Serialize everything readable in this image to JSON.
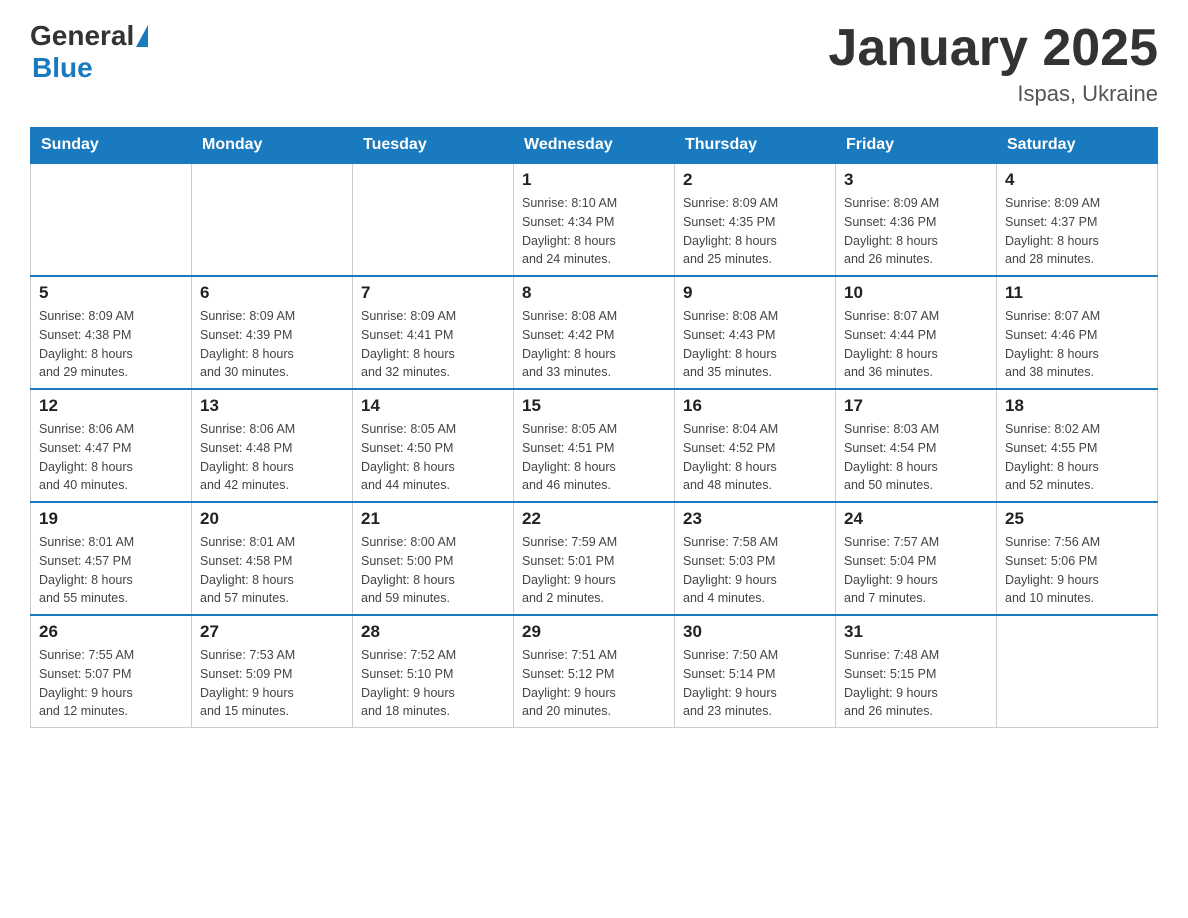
{
  "header": {
    "logo_general": "General",
    "logo_blue": "Blue",
    "month_title": "January 2025",
    "location": "Ispas, Ukraine"
  },
  "days_of_week": [
    "Sunday",
    "Monday",
    "Tuesday",
    "Wednesday",
    "Thursday",
    "Friday",
    "Saturday"
  ],
  "weeks": [
    [
      {
        "day": "",
        "info": ""
      },
      {
        "day": "",
        "info": ""
      },
      {
        "day": "",
        "info": ""
      },
      {
        "day": "1",
        "info": "Sunrise: 8:10 AM\nSunset: 4:34 PM\nDaylight: 8 hours\nand 24 minutes."
      },
      {
        "day": "2",
        "info": "Sunrise: 8:09 AM\nSunset: 4:35 PM\nDaylight: 8 hours\nand 25 minutes."
      },
      {
        "day": "3",
        "info": "Sunrise: 8:09 AM\nSunset: 4:36 PM\nDaylight: 8 hours\nand 26 minutes."
      },
      {
        "day": "4",
        "info": "Sunrise: 8:09 AM\nSunset: 4:37 PM\nDaylight: 8 hours\nand 28 minutes."
      }
    ],
    [
      {
        "day": "5",
        "info": "Sunrise: 8:09 AM\nSunset: 4:38 PM\nDaylight: 8 hours\nand 29 minutes."
      },
      {
        "day": "6",
        "info": "Sunrise: 8:09 AM\nSunset: 4:39 PM\nDaylight: 8 hours\nand 30 minutes."
      },
      {
        "day": "7",
        "info": "Sunrise: 8:09 AM\nSunset: 4:41 PM\nDaylight: 8 hours\nand 32 minutes."
      },
      {
        "day": "8",
        "info": "Sunrise: 8:08 AM\nSunset: 4:42 PM\nDaylight: 8 hours\nand 33 minutes."
      },
      {
        "day": "9",
        "info": "Sunrise: 8:08 AM\nSunset: 4:43 PM\nDaylight: 8 hours\nand 35 minutes."
      },
      {
        "day": "10",
        "info": "Sunrise: 8:07 AM\nSunset: 4:44 PM\nDaylight: 8 hours\nand 36 minutes."
      },
      {
        "day": "11",
        "info": "Sunrise: 8:07 AM\nSunset: 4:46 PM\nDaylight: 8 hours\nand 38 minutes."
      }
    ],
    [
      {
        "day": "12",
        "info": "Sunrise: 8:06 AM\nSunset: 4:47 PM\nDaylight: 8 hours\nand 40 minutes."
      },
      {
        "day": "13",
        "info": "Sunrise: 8:06 AM\nSunset: 4:48 PM\nDaylight: 8 hours\nand 42 minutes."
      },
      {
        "day": "14",
        "info": "Sunrise: 8:05 AM\nSunset: 4:50 PM\nDaylight: 8 hours\nand 44 minutes."
      },
      {
        "day": "15",
        "info": "Sunrise: 8:05 AM\nSunset: 4:51 PM\nDaylight: 8 hours\nand 46 minutes."
      },
      {
        "day": "16",
        "info": "Sunrise: 8:04 AM\nSunset: 4:52 PM\nDaylight: 8 hours\nand 48 minutes."
      },
      {
        "day": "17",
        "info": "Sunrise: 8:03 AM\nSunset: 4:54 PM\nDaylight: 8 hours\nand 50 minutes."
      },
      {
        "day": "18",
        "info": "Sunrise: 8:02 AM\nSunset: 4:55 PM\nDaylight: 8 hours\nand 52 minutes."
      }
    ],
    [
      {
        "day": "19",
        "info": "Sunrise: 8:01 AM\nSunset: 4:57 PM\nDaylight: 8 hours\nand 55 minutes."
      },
      {
        "day": "20",
        "info": "Sunrise: 8:01 AM\nSunset: 4:58 PM\nDaylight: 8 hours\nand 57 minutes."
      },
      {
        "day": "21",
        "info": "Sunrise: 8:00 AM\nSunset: 5:00 PM\nDaylight: 8 hours\nand 59 minutes."
      },
      {
        "day": "22",
        "info": "Sunrise: 7:59 AM\nSunset: 5:01 PM\nDaylight: 9 hours\nand 2 minutes."
      },
      {
        "day": "23",
        "info": "Sunrise: 7:58 AM\nSunset: 5:03 PM\nDaylight: 9 hours\nand 4 minutes."
      },
      {
        "day": "24",
        "info": "Sunrise: 7:57 AM\nSunset: 5:04 PM\nDaylight: 9 hours\nand 7 minutes."
      },
      {
        "day": "25",
        "info": "Sunrise: 7:56 AM\nSunset: 5:06 PM\nDaylight: 9 hours\nand 10 minutes."
      }
    ],
    [
      {
        "day": "26",
        "info": "Sunrise: 7:55 AM\nSunset: 5:07 PM\nDaylight: 9 hours\nand 12 minutes."
      },
      {
        "day": "27",
        "info": "Sunrise: 7:53 AM\nSunset: 5:09 PM\nDaylight: 9 hours\nand 15 minutes."
      },
      {
        "day": "28",
        "info": "Sunrise: 7:52 AM\nSunset: 5:10 PM\nDaylight: 9 hours\nand 18 minutes."
      },
      {
        "day": "29",
        "info": "Sunrise: 7:51 AM\nSunset: 5:12 PM\nDaylight: 9 hours\nand 20 minutes."
      },
      {
        "day": "30",
        "info": "Sunrise: 7:50 AM\nSunset: 5:14 PM\nDaylight: 9 hours\nand 23 minutes."
      },
      {
        "day": "31",
        "info": "Sunrise: 7:48 AM\nSunset: 5:15 PM\nDaylight: 9 hours\nand 26 minutes."
      },
      {
        "day": "",
        "info": ""
      }
    ]
  ]
}
